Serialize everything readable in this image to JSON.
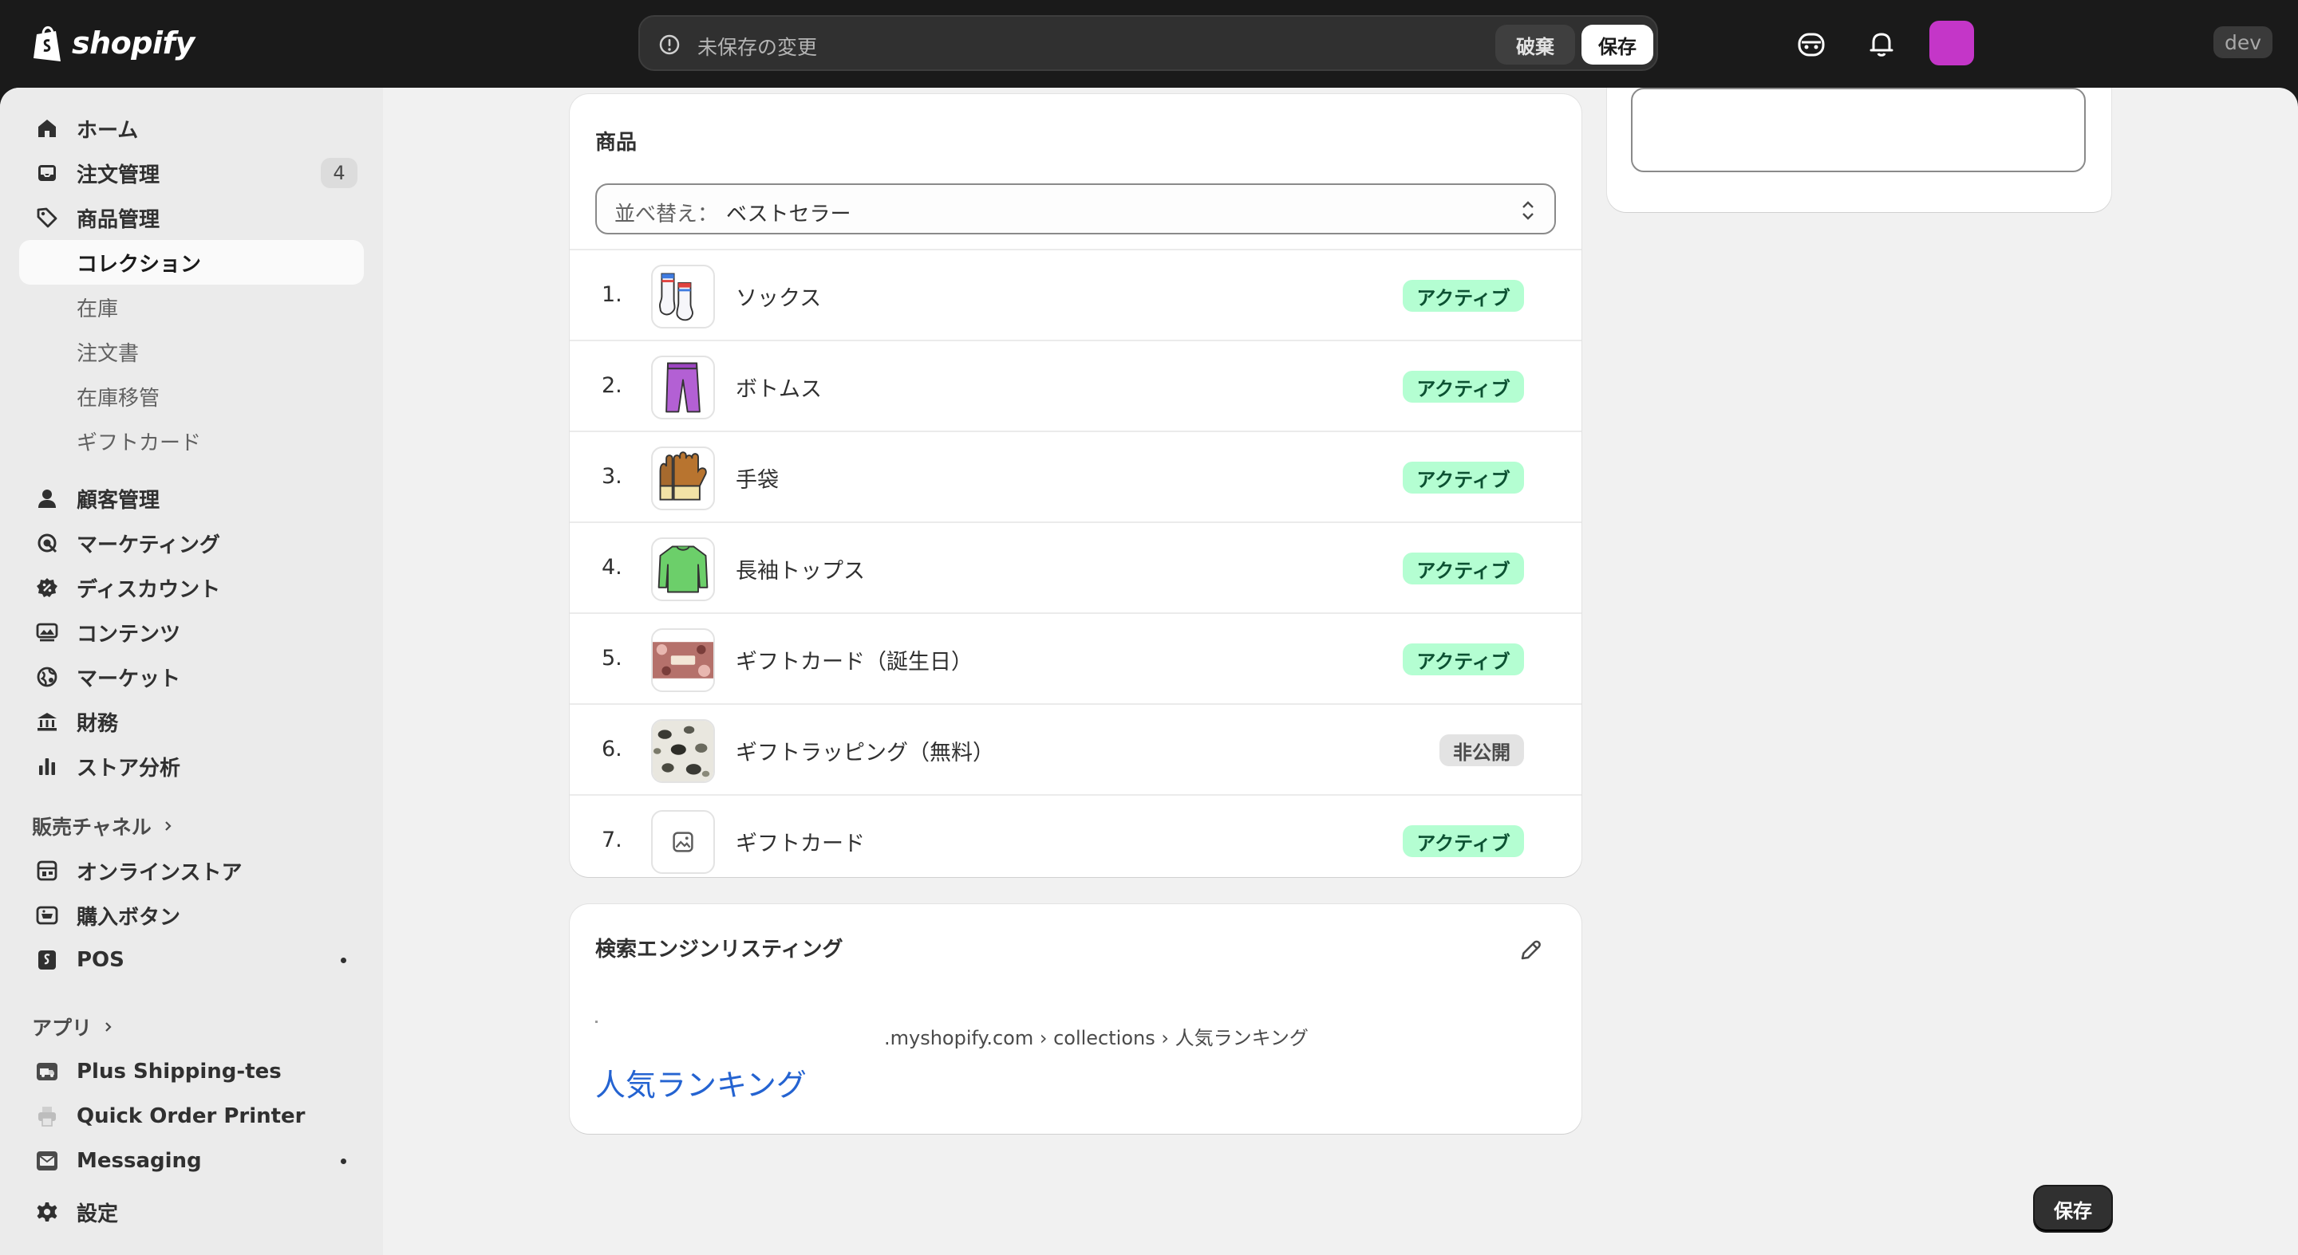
{
  "topbar": {
    "brand": "shopify",
    "unsaved_message": "未保存の変更",
    "discard_label": "破棄",
    "save_label": "保存",
    "dev_label": "dev",
    "avatar_color": "#c436c8"
  },
  "sidebar": {
    "items": [
      {
        "label": "ホーム",
        "icon": "home-icon"
      },
      {
        "label": "注文管理",
        "icon": "inbox-icon",
        "badge": "4"
      },
      {
        "label": "商品管理",
        "icon": "tag-icon"
      },
      {
        "label": "コレクション",
        "selected": true
      },
      {
        "label": "在庫"
      },
      {
        "label": "注文書"
      },
      {
        "label": "在庫移管"
      },
      {
        "label": "ギフトカード"
      },
      {
        "label": "顧客管理",
        "icon": "person-icon"
      },
      {
        "label": "マーケティング",
        "icon": "target-icon"
      },
      {
        "label": "ディスカウント",
        "icon": "discount-icon"
      },
      {
        "label": "コンテンツ",
        "icon": "content-icon"
      },
      {
        "label": "マーケット",
        "icon": "globe-icon"
      },
      {
        "label": "財務",
        "icon": "bank-icon"
      },
      {
        "label": "ストア分析",
        "icon": "chart-icon"
      }
    ],
    "sales_channels_heading": "販売チャネル",
    "sales_channels": [
      {
        "label": "オンラインストア",
        "icon": "store-icon"
      },
      {
        "label": "購入ボタン",
        "icon": "buy-button-icon"
      },
      {
        "label": "POS",
        "icon": "pos-icon"
      }
    ],
    "apps_heading": "アプリ",
    "apps": [
      {
        "label": "Plus Shipping-tes",
        "icon": "truck-app-icon"
      },
      {
        "label": "Quick Order Printer",
        "icon": "printer-app-icon"
      },
      {
        "label": "Messaging",
        "icon": "email-app-icon"
      }
    ],
    "settings_label": "設定"
  },
  "products": {
    "title": "商品",
    "sort_label": "並べ替え：",
    "sort_value": "ベストセラー",
    "rows": [
      {
        "num": "1.",
        "name": "ソックス",
        "status": "アクティブ",
        "thumb": "socks-thumbnail"
      },
      {
        "num": "2.",
        "name": "ボトムス",
        "status": "アクティブ",
        "thumb": "pants-thumbnail"
      },
      {
        "num": "3.",
        "name": "手袋",
        "status": "アクティブ",
        "thumb": "gloves-thumbnail"
      },
      {
        "num": "4.",
        "name": "長袖トップス",
        "status": "アクティブ",
        "thumb": "sweater-thumbnail"
      },
      {
        "num": "5.",
        "name": "ギフトカード（誕生日）",
        "status": "アクティブ",
        "thumb": "birthday-card-thumbnail"
      },
      {
        "num": "6.",
        "name": "ギフトラッピング（無料）",
        "status": "非公開",
        "thumb": "wrapping-thumbnail"
      },
      {
        "num": "7.",
        "name": "ギフトカード",
        "status": "アクティブ",
        "thumb": "image-placeholder-icon"
      }
    ]
  },
  "seo": {
    "title": "検索エンジンリスティング",
    "url": ".myshopify.com › collections › 人気ランキング",
    "page_title": "人気ランキング"
  },
  "footer": {
    "save_label": "保存"
  },
  "colors": {
    "active_badge_bg": "#b4fed2",
    "active_badge_text": "#0c5132",
    "draft_badge_bg": "#e3e3e3",
    "link_blue": "#2463d1",
    "topbar_bg": "#1a1a1a"
  }
}
